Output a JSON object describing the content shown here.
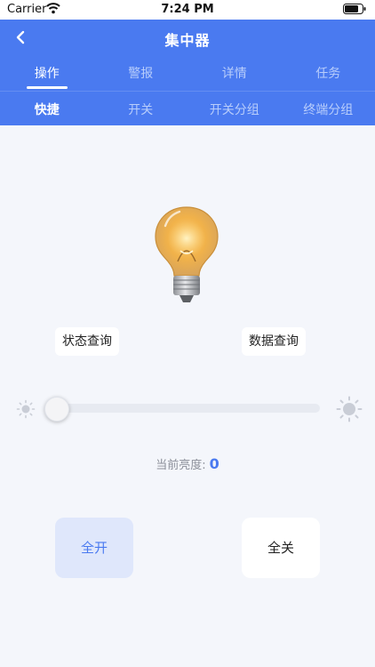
{
  "status_bar": {
    "carrier": "Carrier",
    "time": "7:24 PM"
  },
  "header": {
    "title": "集中器",
    "back_icon": "chevron-left-icon"
  },
  "tabs_primary": [
    {
      "label": "操作",
      "active": true
    },
    {
      "label": "警报",
      "active": false
    },
    {
      "label": "详情",
      "active": false
    },
    {
      "label": "任务",
      "active": false
    }
  ],
  "tabs_secondary": [
    {
      "label": "快捷",
      "active": true
    },
    {
      "label": "开关",
      "active": false
    },
    {
      "label": "开关分组",
      "active": false
    },
    {
      "label": "终端分组",
      "active": false
    }
  ],
  "device": {
    "icon": "light-bulb-icon"
  },
  "actions": {
    "status_query": "状态查询",
    "data_query": "数据查询"
  },
  "slider": {
    "min_icon": "sun-low-icon",
    "max_icon": "sun-high-icon",
    "value": 0
  },
  "brightness": {
    "label": "当前亮度:",
    "value": "0"
  },
  "power": {
    "all_on": "全开",
    "all_off": "全关"
  },
  "colors": {
    "accent": "#4a7af0",
    "background": "#f4f6fb",
    "on_button_bg": "#dfe7fb"
  }
}
